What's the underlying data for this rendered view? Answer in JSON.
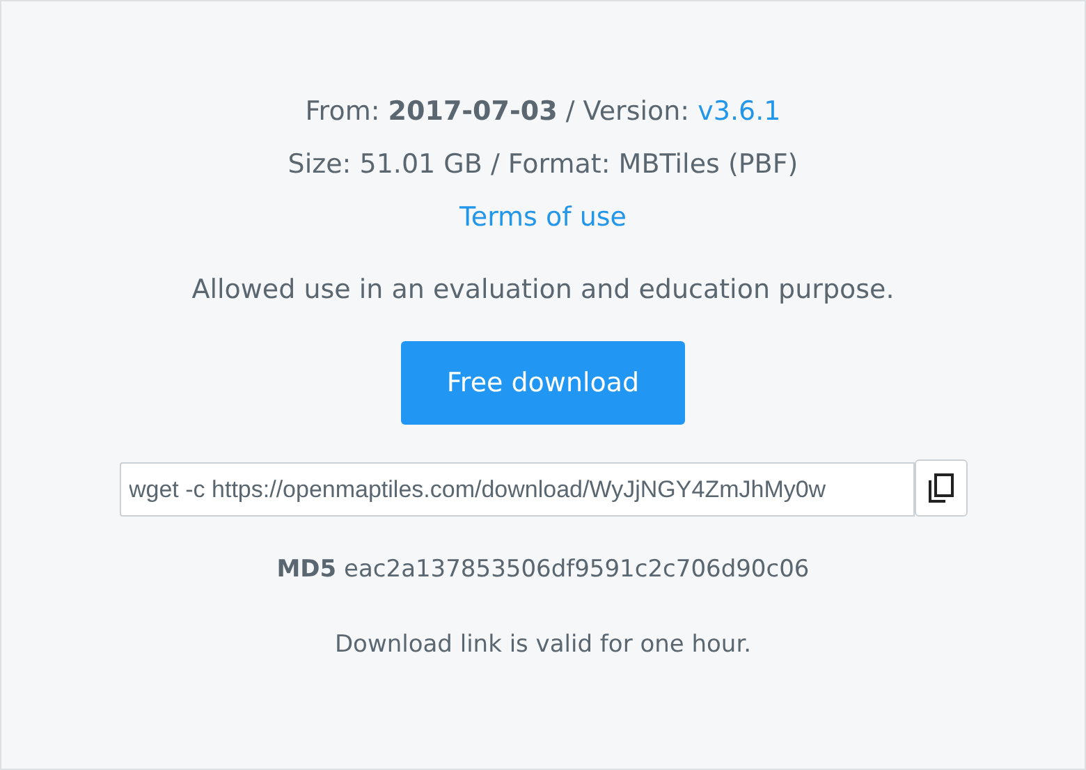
{
  "info": {
    "from_text": "From: **2017-07-03** / Version: ",
    "version_link": "v3.6.1",
    "size_line": "Size: 51.01 GB / Format: MBTiles (PBF)",
    "terms_link": "Terms of use"
  },
  "usage_note": "Allowed use in an evaluation and education purpose.",
  "download_button": "Free download",
  "command_field": {
    "value": "wget -c https://openmaptiles.com/download/WyJjNGY4ZmJhMy0w"
  },
  "md5": {
    "label": "MD5",
    "value": "eac2a137853506df9591c2c706d90c06"
  },
  "validity_note": "Download link is valid for one hour."
}
